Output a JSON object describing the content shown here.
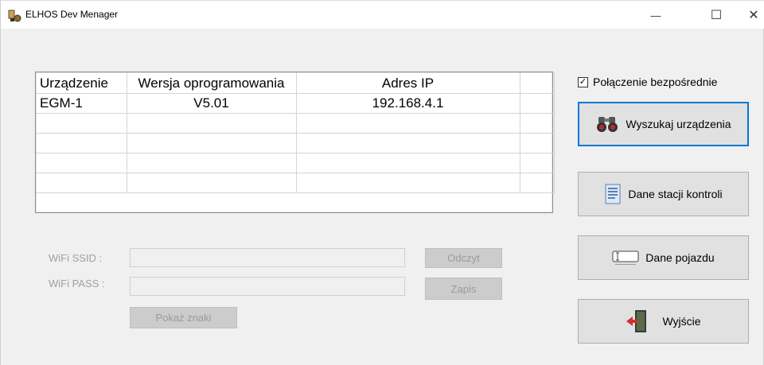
{
  "window": {
    "title": "ELHOS Dev Menager",
    "controls": {
      "minimize": "—",
      "maximize": "☐",
      "close": "✕"
    }
  },
  "device_table": {
    "columns": [
      "Urządzenie",
      "Wersja oprogramowania",
      "Adres IP",
      ""
    ],
    "rows": [
      [
        "EGM-1",
        "V5.01",
        "192.168.4.1",
        ""
      ],
      [
        "",
        "",
        "",
        ""
      ],
      [
        "",
        "",
        "",
        ""
      ],
      [
        "",
        "",
        "",
        ""
      ],
      [
        "",
        "",
        "",
        ""
      ]
    ]
  },
  "direct_connection": {
    "label": "Połączenie bezpośrednie",
    "checked": true,
    "check_glyph": "✓"
  },
  "buttons": {
    "search": "Wyszukaj urządzenia",
    "station_data": "Dane stacji kontroli",
    "vehicle_data": "Dane pojazdu",
    "exit": "Wyjście"
  },
  "wifi": {
    "ssid_label": "WiFi SSID :",
    "pass_label": "WiFi PASS :",
    "ssid_value": "",
    "pass_value": "",
    "read_button": "Odczyt",
    "write_button": "Zapis",
    "show_chars_button": "Pokaż znaki"
  },
  "icons": {
    "app": "app-icon",
    "search": "binoculars-icon",
    "station": "document-icon",
    "vehicle": "text-field-icon",
    "exit": "exit-door-icon"
  },
  "colors": {
    "focus_border": "#0078d7",
    "disabled_text": "#a0a0a0",
    "button_face": "#e1e1e1"
  }
}
